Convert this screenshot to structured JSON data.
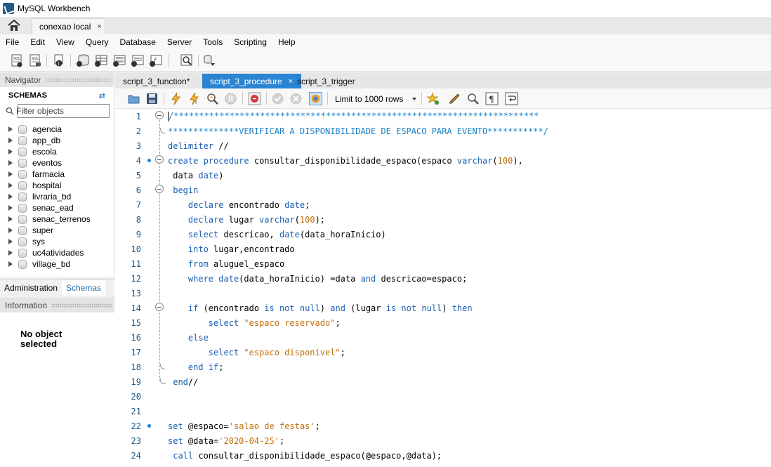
{
  "window": {
    "title": "MySQL Workbench"
  },
  "connection_tab": {
    "label": "conexao local",
    "close": "×"
  },
  "menu": [
    "File",
    "Edit",
    "View",
    "Query",
    "Database",
    "Server",
    "Tools",
    "Scripting",
    "Help"
  ],
  "navigator": {
    "header": "Navigator",
    "schemas_title": "SCHEMAS",
    "filter_placeholder": "Filter objects",
    "schemas": [
      "agencia",
      "app_db",
      "escola",
      "eventos",
      "farmacia",
      "hospital",
      "livraria_bd",
      "senac_ead",
      "senac_terrenos",
      "super",
      "sys",
      "uc4atividades",
      "village_bd"
    ],
    "tabs": [
      "Administration",
      "Schemas"
    ],
    "info_header": "Information",
    "no_object": "No object\nselected"
  },
  "editor": {
    "tabs": [
      {
        "label": "script_3_function*",
        "active": false
      },
      {
        "label": "script_3_procedure",
        "active": true
      },
      {
        "label": "script_3_trigger",
        "active": false
      }
    ],
    "limit_rows": "Limit to 1000 rows",
    "lines": [
      "/************************************************************************",
      "**************VERIFICAR A DISPONIBILIDADE DE ESPACO PARA EVENTO***********/",
      "delimiter //",
      "create procedure consultar_disponibilidade_espaco(espaco varchar(100),",
      " data date)",
      " begin",
      "    declare encontrado date;",
      "    declare lugar varchar(100);",
      "    select descricao, date(data_horaInicio)",
      "    into lugar,encontrado",
      "    from aluguel_espaco",
      "    where date(data_horaInicio) =data and descricao=espaco;",
      "",
      "    if (encontrado is not null) and (lugar is not null) then",
      "        select \"espaco reservado\";",
      "    else",
      "        select \"espaco disponivel\";",
      "    end if;",
      " end//",
      "",
      "",
      "set @espaco='salao de festas';",
      "set @data='2020-04-25';",
      " call consultar_disponibilidade_espaco(@espaco,@data);"
    ]
  },
  "colors": {
    "keyword": "#1a5fb4",
    "comment": "#1a80c8",
    "string": "#c2700a",
    "active_tab": "#2a84d2"
  }
}
